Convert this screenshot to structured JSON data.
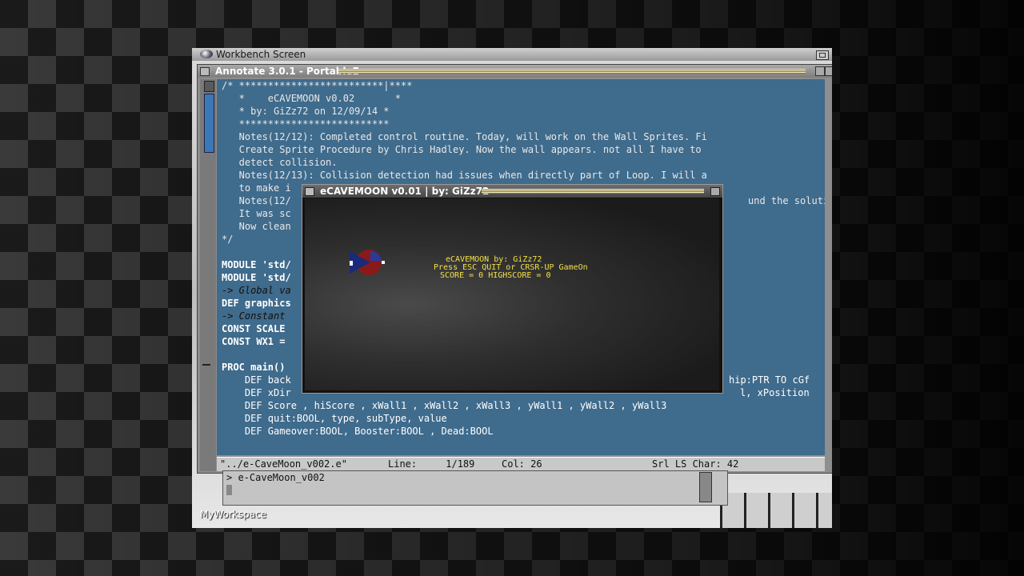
{
  "screen": {
    "title": "Workbench Screen",
    "workspace_label": "MyWorkspace"
  },
  "editor": {
    "title": "Annotate 3.0.1 - PortableE",
    "code_lines": [
      "/* *************************|****",
      "   *    eCAVEMOON v0.02       *",
      "   * by: GiZz72 on 12/09/14 *",
      "   **************************",
      "   Notes(12/12): Completed control routine. Today, will work on the Wall Sprites. Fi",
      "   Create Sprite Procedure by Chris Hadley. Now the wall appears. not all I have to",
      "   detect collision.",
      "   Notes(12/13): Collision detection had issues when directly part of Loop. I will a",
      "   to make i",
      "   Notes(12/",
      "   It was sc",
      "   Now clean",
      "*/",
      "",
      "MODULE 'std/",
      "MODULE 'std/",
      "-> Global va",
      "DEF graphics",
      "-> Constant",
      "CONST SCALE",
      "CONST WX1 =",
      "",
      "PROC main()",
      "    DEF back",
      "    DEF xDir",
      "    DEF Score , hiScore , xWall1 , xWall2 , xWall3 , yWall1 , yWall2 , yWall3",
      "    DEF quit:BOOL, type, subType, value",
      "    DEF Gameover:BOOL, Booster:BOOL , Dead:BOOL"
    ],
    "right_fragments": {
      "notes_tail": "und the soluti",
      "def_back_tail": "hip:PTR TO cGf",
      "def_xdir_tail": "l, xPosition"
    },
    "status": {
      "file": "\"../e-CaveMoon_v002.e\"",
      "line": "Line:     1/189",
      "col": "Col: 26",
      "flags": "Srl LS Char: 42"
    }
  },
  "shell": {
    "prompt": "> e-CaveMoon_v002"
  },
  "game": {
    "title": "eCAVEMOON v0.01 | by: GiZz72",
    "line1": "eCAVEMOON by: GiZz72",
    "line2": "Press ESC QUIT or CRSR-UP GameOn",
    "line3": "SCORE = 0 HIGHSCORE = 0"
  }
}
